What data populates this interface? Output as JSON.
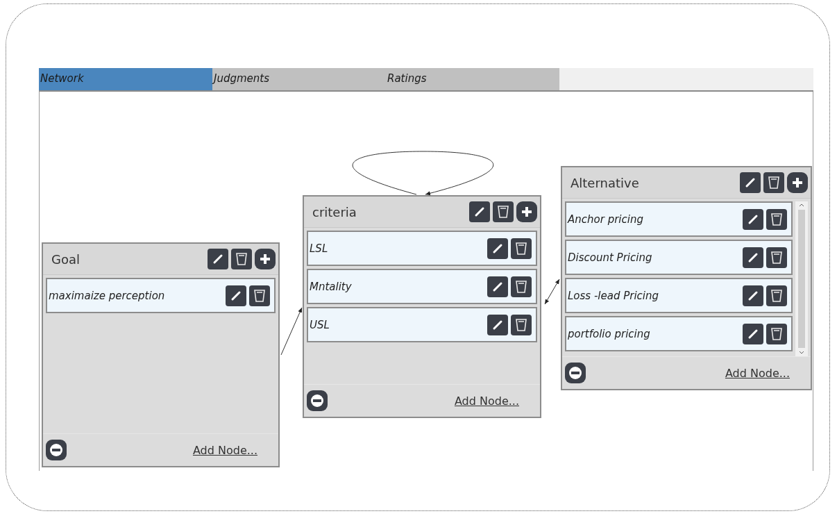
{
  "tabs": [
    {
      "label": "Network",
      "selected": true
    },
    {
      "label": "Judgments",
      "selected": false
    },
    {
      "label": "Ratings",
      "selected": false
    }
  ],
  "clusters": [
    {
      "title": "Goal",
      "scrollable": false,
      "add_link": "Add Node...",
      "nodes": [
        {
          "name": "maximaize perception"
        }
      ]
    },
    {
      "title": "criteria",
      "scrollable": false,
      "add_link": "Add Node...",
      "nodes": [
        {
          "name": "LSL"
        },
        {
          "name": "Mntality"
        },
        {
          "name": "USL"
        }
      ]
    },
    {
      "title": "Alternative",
      "scrollable": true,
      "add_link": "Add Node...",
      "nodes": [
        {
          "name": "Anchor pricing"
        },
        {
          "name": "Discount Pricing"
        },
        {
          "name": "Loss -lead Pricing"
        },
        {
          "name": "portfolio pricing"
        }
      ]
    }
  ]
}
